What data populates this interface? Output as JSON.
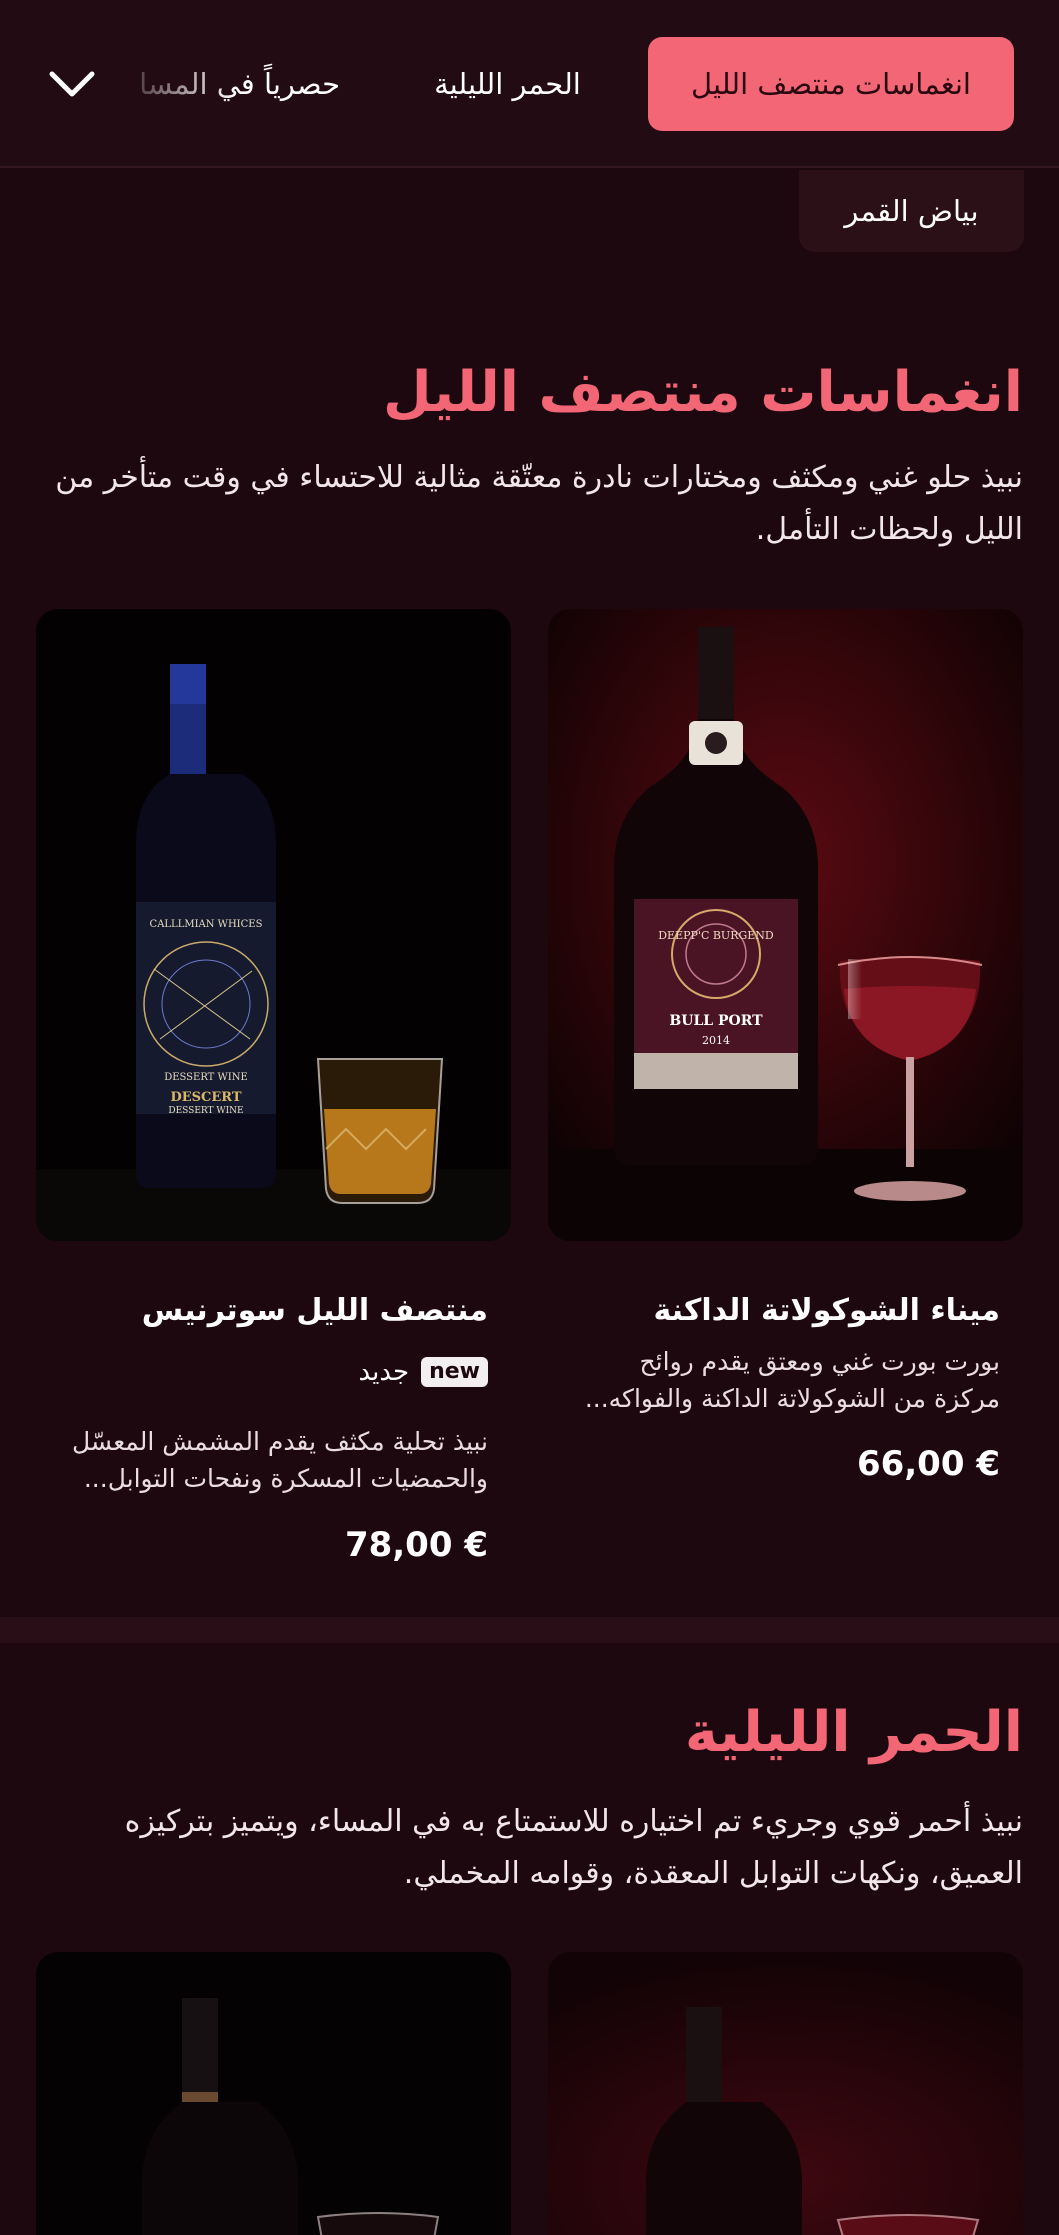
{
  "nav": {
    "tabs": [
      {
        "label": "انغماسات منتصف الليل",
        "active": true
      },
      {
        "label": "الحمر الليلية",
        "active": false
      },
      {
        "label": "حصرياً في المسا",
        "active": false
      }
    ],
    "more_icon": "chevron-down-icon",
    "sub_chip": "بياض القمر"
  },
  "colors": {
    "accent": "#f26675",
    "background": "#1e0810",
    "nav_background": "#220b13"
  },
  "sections": [
    {
      "title": "انغماسات منتصف الليل",
      "description": "نبيذ حلو غني ومكثف ومختارات نادرة معتّقة مثالية للاحتساء في وقت متأخر من الليل ولحظات التأمل.",
      "products": [
        {
          "name": "ميناء الشوكولاتة الداكنة",
          "description": "بورت بورت غني ومعتق يقدم روائح مركزة من الشوكولاتة الداكنة والفواكه...",
          "price": "66,00 €",
          "label_text": {
            "brand": "DEEPP'C BURGEND",
            "product": "BULL PORT",
            "year": "2014"
          }
        },
        {
          "name": "منتصف الليل سوترنيس",
          "badge": "new",
          "badge_label": "جديد",
          "description": "نبيذ تحلية مكثف يقدم المشمش المعسّل والحمضيات المسكرة ونفحات التوابل...",
          "price": "78,00 €",
          "label_text": {
            "brand": "CALLLMIAN WHICES",
            "product": "DESSERT WINE",
            "bottom1": "DESCERT",
            "bottom2": "DESSERT WINE"
          }
        }
      ]
    },
    {
      "title": "الحمر الليلية",
      "description": "نبيذ أحمر قوي وجريء تم اختياره للاستمتاع به في المساء، ويتميز بتركيزه العميق، ونكهات التوابل المعقدة، وقوامه المخملي."
    }
  ]
}
